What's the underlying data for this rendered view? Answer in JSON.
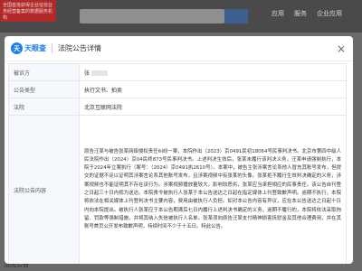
{
  "background": {
    "banner_text": "全国首批获得企业征信业务经营备案的数据服务机构",
    "search_placeholder": "请输入公司名称、人名、品牌名称等关键词",
    "search_button": "查公司",
    "nav_items": [
      "应用",
      "服务",
      "企业应用"
    ],
    "footer_text": "法院公告"
  },
  "modal": {
    "logo_mark": "天",
    "logo_text": "天眼查",
    "title": "法院公告详情",
    "close": "×",
    "rows": [
      {
        "label": "被诉方",
        "value": "张"
      },
      {
        "label": "公告类型",
        "value": "执行文书、拍卖"
      },
      {
        "label": "法院",
        "value": "北京互联网法院"
      },
      {
        "label": "法院公告内容",
        "value": "原告汪某与被告张某网络侵权责任纠纷一案，本院作出（2023）京0491民初18064号民事判决书。北京市第四中级人民法院作出（2024）京04民终873号民事判决书。上述判决生效后，张某未履行该判决义务，汪某申请强制执行，本院于2024年立案执行（案号：（2024）京0491执2610号）。本案中，被告主张涉案言论系他人冒充其账号发布，但提交的证据不足以证明其涉案言论系其他账号发布，且涉案视频中有张某的头像。张某拒不履行生效判决确定的义务，涉案视频也不能证明其不存在该行为。涉案视频播放量较大，影响较恶劣，张某应当承担相应的民事责任。该公告自刊登之日起三十日内视为送达。本院责令被执行人张某于本公告送达之日起在指定媒体上刊登致歉声明。逾期不执行，本院将依法在相关媒体上刊登判决书主要内容，费用由被执行人负担。如对本公告内容有异议，应在本公告送达之日起十日内向本院提出。被执行人张某应于本公告期满后七日内履行上述判决书确定的义务，逾期不履行的，本院将依法采取拘留、罚款等强制措施，并将其纳入失信被执行人名单。张某须向原告汪某支付精神损害抚慰金及其他合理费用，并在其账号首页公开发布致歉声明，持续时间不少于十五日。特此公告。"
      }
    ]
  }
}
